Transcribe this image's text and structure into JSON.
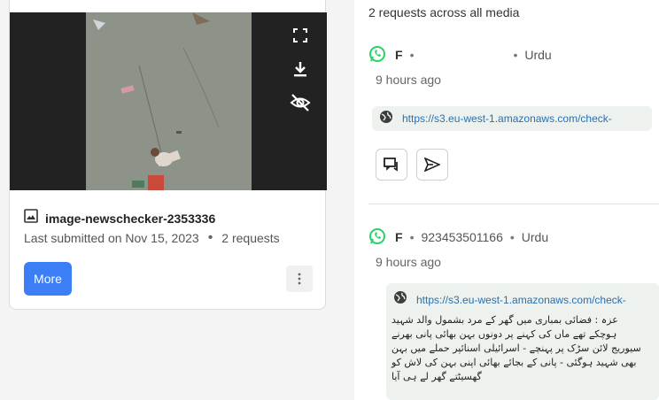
{
  "media": {
    "title": "image-newschecker-2353336",
    "last_submitted": "Last submitted on Nov 15, 2023",
    "requests": "2 requests",
    "more_label": "More",
    "icons": [
      "fullscreen-icon",
      "download-icon",
      "visibility-off-icon",
      "image-icon",
      "more-vertical-icon"
    ]
  },
  "requests_panel": {
    "summary": "2 requests across all media",
    "items": [
      {
        "name": "F",
        "phone": "",
        "language": "Urdu",
        "time": "9 hours ago",
        "link": "https://s3.eu-west-1.amazonaws.com/check-",
        "icons": [
          "whatsapp-icon",
          "globe-icon",
          "reply-icon",
          "send-icon"
        ]
      },
      {
        "name": "F",
        "phone": "923453501166",
        "language": "Urdu",
        "time": "9 hours ago",
        "link": "https://s3.eu-west-1.amazonaws.com/check-",
        "message": "عزہ : فضائی بمباری میں گھر کے مرد بشمول والد شہید ہوچکے تھے ماں کی کہنے پر دونوں بہن بھائی پانی بھرنے سیوریج لائن سڑک پر پہنچے - اسرائیلی اسنائپر حملے میں بہن بھی شہید ہوگئی - پانی کے بجائے بھائی اپنی بہن کی لاش کو گھسیٹتے گھر لے ہی آیا",
        "icons": [
          "whatsapp-icon",
          "globe-icon"
        ]
      }
    ]
  },
  "colors": {
    "accent": "#3b7ef6",
    "whatsapp": "#25d366",
    "link": "#2a6fb0"
  }
}
